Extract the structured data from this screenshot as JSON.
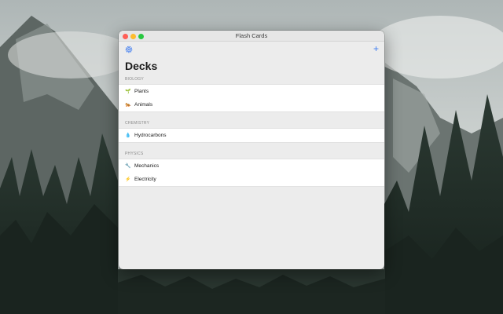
{
  "window": {
    "title": "Flash Cards"
  },
  "toolbar": {
    "add_label": "+",
    "settings_icon": "gear-icon"
  },
  "page": {
    "heading": "Decks"
  },
  "sections": [
    {
      "header": "BIOLOGY",
      "decks": [
        {
          "emoji": "🌱",
          "name": "Plants"
        },
        {
          "emoji": "🐅",
          "name": "Animals"
        }
      ]
    },
    {
      "header": "CHEMISTRY",
      "decks": [
        {
          "emoji": "💧",
          "name": "Hydrocarbons"
        }
      ]
    },
    {
      "header": "PHYSICS",
      "decks": [
        {
          "emoji": "🔧",
          "name": "Mechanics"
        },
        {
          "emoji": "⚡",
          "name": "Electricity"
        }
      ]
    }
  ],
  "colors": {
    "accent": "#3d7bf0",
    "window_bg": "#ececec",
    "row_bg": "#ffffff"
  }
}
